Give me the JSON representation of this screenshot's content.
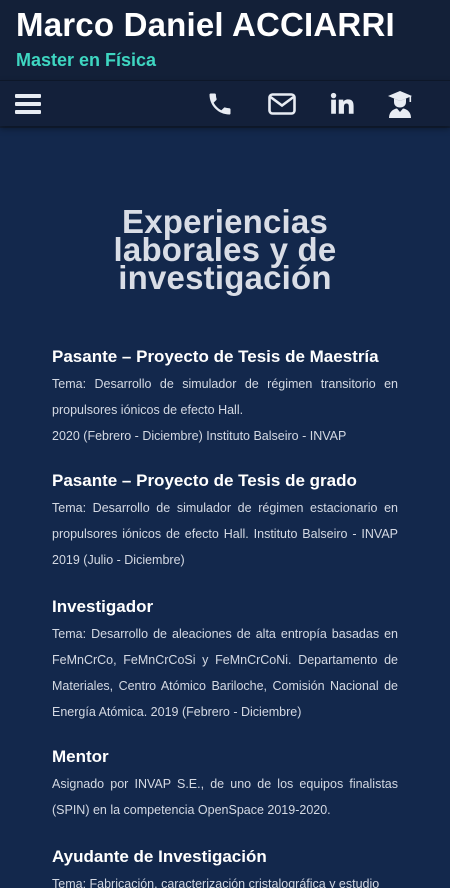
{
  "header": {
    "name": "Marco Daniel ACCIARRI",
    "subtitle": "Master en Física"
  },
  "nav": {
    "icons": [
      "menu-icon",
      "phone-icon",
      "mail-icon",
      "linkedin-icon",
      "graduate-icon"
    ]
  },
  "colors": {
    "background": "#13284c",
    "header": "#132038",
    "accent": "#3ed6c1"
  },
  "section": {
    "title_line1": "Experiencias",
    "title_line2": "laborales y de",
    "title_line3": "investigación"
  },
  "experiences": [
    {
      "title": "Pasante – Proyecto de Tesis de Maestría",
      "lines": [
        "Tema: Desarrollo de simulador de régimen transitorio en propulsores iónicos de efecto Hall.",
        "2020 (Febrero - Diciembre) Instituto Balseiro - INVAP"
      ]
    },
    {
      "title": "Pasante – Proyecto de Tesis de grado",
      "lines": [
        "Tema: Desarrollo de simulador de régimen estacionario en propulsores iónicos de efecto Hall. Instituto Balseiro - INVAP 2019 (Julio - Diciembre)"
      ]
    },
    {
      "title": "Investigador",
      "lines": [
        "Tema: Desarrollo de aleaciones de alta entropía basadas en FeMnCrCo, FeMnCrCoSi y FeMnCrCoNi. Departamento de Materiales, Centro Atómico Bariloche, Comisión Nacional de Energía Atómica. 2019 (Febrero - Diciembre)"
      ]
    },
    {
      "title": "Mentor",
      "lines": [
        "Asignado por INVAP S.E., de uno de los equipos finalistas (SPIN) en la competencia OpenSpace 2019-2020."
      ]
    },
    {
      "title": "Ayudante de Investigación",
      "lines": [
        "Tema: Fabricación, caracterización cristalográfica y estudio"
      ]
    }
  ]
}
